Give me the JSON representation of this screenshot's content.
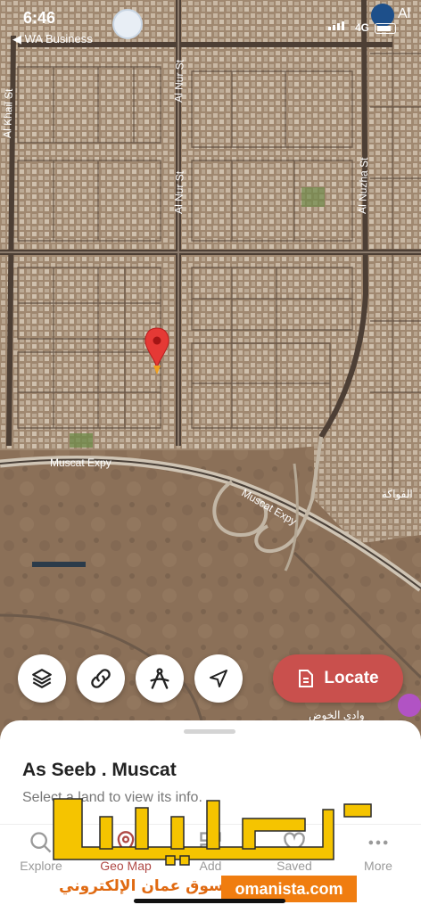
{
  "status_bar": {
    "time": "6:46",
    "back_label": "◀ WA Business",
    "network": "4G"
  },
  "map": {
    "street_labels": {
      "al_khail": "Al Khail St",
      "al_nur_north": "Al Nur St",
      "al_nur_south": "Al Nur St",
      "al_nuzha": "Al Nuzha St",
      "expy_left": "Muscat Expy",
      "expy_right": "Muscat Expy",
      "poi_right": "الفواكة",
      "poi_bottom": "وادي الخوض",
      "corner_top": "Al"
    }
  },
  "controls": {
    "locate_label": "Locate"
  },
  "sheet": {
    "place_name": "As Seeb . Muscat",
    "hint": "Select a land to view its info."
  },
  "bottom_nav": {
    "items": [
      {
        "label": "Explore",
        "icon": "search-icon"
      },
      {
        "label": "Geo Map",
        "icon": "map-pin-icon",
        "active": true
      },
      {
        "label": "Add",
        "icon": "add-icon"
      },
      {
        "label": "Saved",
        "icon": "heart-icon"
      },
      {
        "label": "More",
        "icon": "more-icon"
      }
    ]
  },
  "watermark": {
    "arabic_logo": "عمانيستا",
    "arabic_tagline": "سوق عمان الإلكتروني",
    "site": "omanista.com"
  },
  "colors": {
    "accent": "#c9504d",
    "active_nav": "#b04a46",
    "watermark_yellow": "#f5c400",
    "watermark_orange": "#f07d10"
  }
}
